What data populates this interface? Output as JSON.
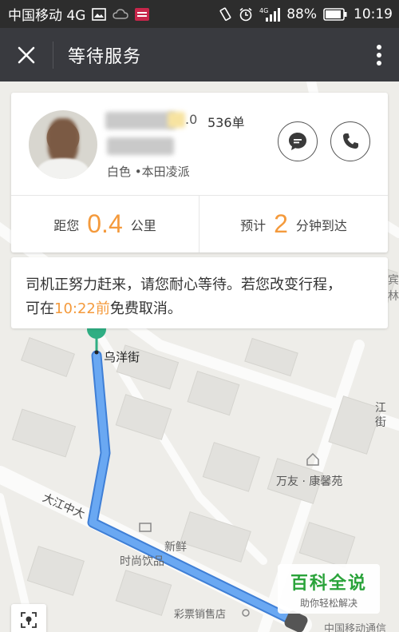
{
  "status_bar": {
    "carrier": "中国移动 4G",
    "network": "4G",
    "battery": "88%",
    "time": "10:19"
  },
  "header": {
    "title": "等待服务"
  },
  "driver": {
    "rating_suffix": ".0",
    "orders": "536单",
    "car": "白色 •本田凌派"
  },
  "metrics": {
    "distance_prefix": "距您",
    "distance_value": "0.4",
    "distance_unit": "公里",
    "eta_prefix": "预计",
    "eta_value": "2",
    "eta_unit": "分钟到达"
  },
  "notice": {
    "line1": "司机正努力赶来，请您耐心等待。若您改变行程，",
    "line2_prefix": "可在",
    "cancel_time": "10:22前",
    "line2_suffix": "免费取消。"
  },
  "map": {
    "labels": {
      "start_street": "乌洋街",
      "road_daijiang": "大江中大",
      "poi_wanyou": "万友 · 康馨苑",
      "poi_shishang": "时尚饮品",
      "poi_xinxian": "新鲜",
      "poi_caipiao": "彩票销售店",
      "poi_mobile": "中国移动通信",
      "road_jiang": "江街",
      "edge_bin": "宾",
      "edge_lin": "林"
    }
  },
  "watermark": {
    "title": "百科全说",
    "subtitle": "助你轻松解决"
  },
  "colors": {
    "accent": "#f49a3c",
    "route": "#5b9cf0",
    "header_bg": "#393a3f"
  }
}
